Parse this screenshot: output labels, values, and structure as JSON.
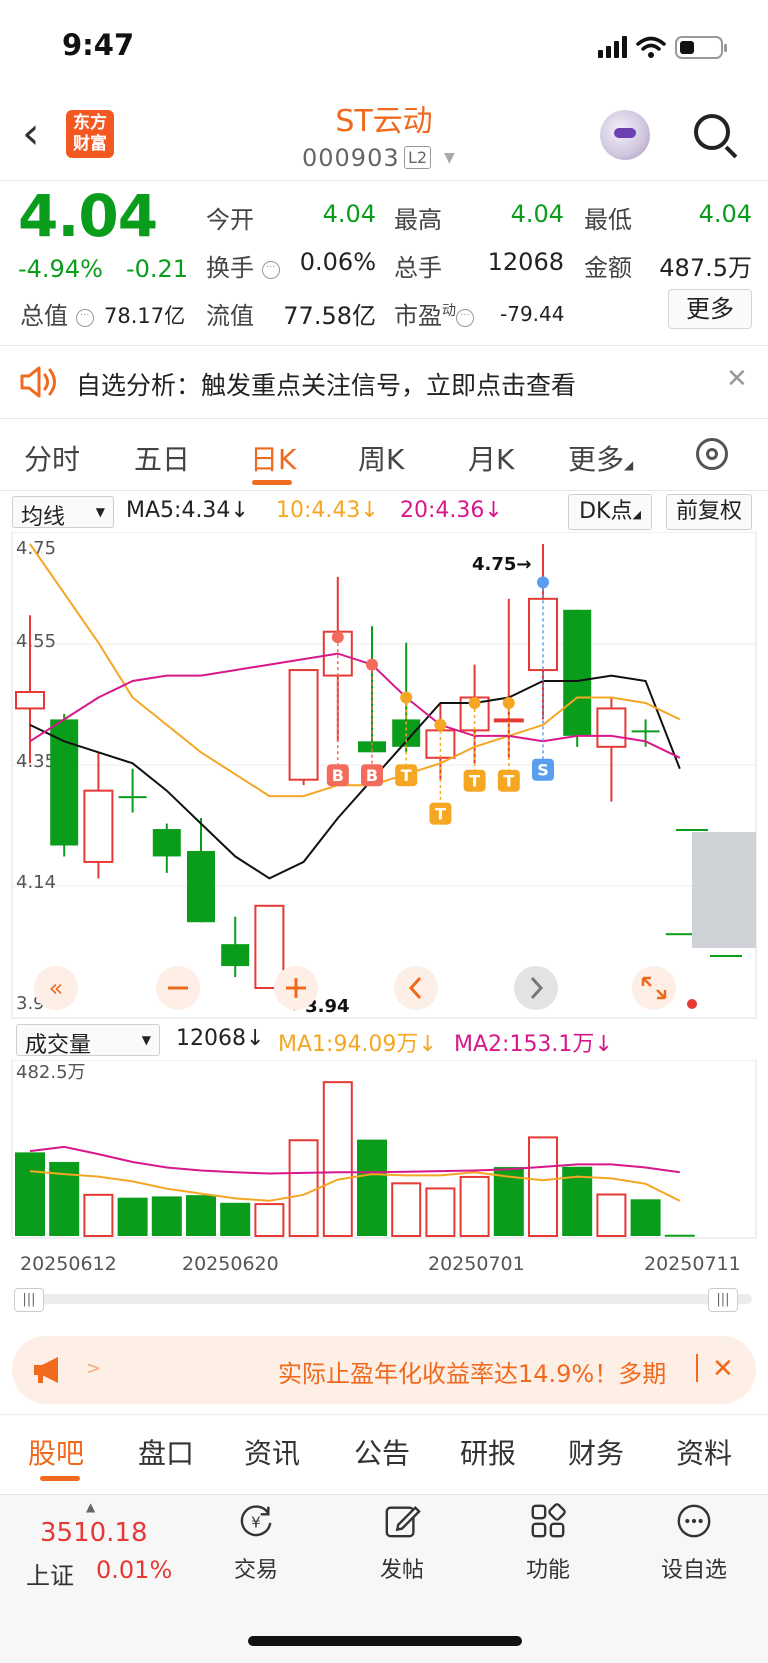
{
  "status_bar": {
    "time": "9:47"
  },
  "header": {
    "logo_text": "东方财富",
    "stock_name": "ST云动",
    "stock_code": "000903",
    "level_badge": "L2"
  },
  "quote": {
    "price": "4.04",
    "change_pct": "-4.94%",
    "change_abs": "-0.21",
    "fields": {
      "open_label": "今开",
      "open": "4.04",
      "high_label": "最高",
      "high": "4.04",
      "low_label": "最低",
      "low": "4.04",
      "turnover_label": "换手",
      "turnover": "0.06%",
      "volume_label": "总手",
      "volume": "12068",
      "amount_label": "金额",
      "amount": "487.5万",
      "mktcap_label": "总值",
      "mktcap": "78.17亿",
      "float_label": "流值",
      "float": "77.58亿",
      "pe_label": "市盈",
      "pe_sup": "动",
      "pe": "-79.44"
    },
    "more_label": "更多"
  },
  "notice": {
    "text": "自选分析：触发重点关注信号，立即点击查看"
  },
  "tabs": [
    {
      "label": "分时"
    },
    {
      "label": "五日"
    },
    {
      "label": "日K"
    },
    {
      "label": "周K"
    },
    {
      "label": "月K"
    },
    {
      "label": "更多"
    }
  ],
  "kline": {
    "indicator_select": "均线",
    "ma5": "MA5:4.34",
    "ma10": "10:4.43",
    "ma20": "20:4.36",
    "dk_label": "DK点",
    "restore_label": "前复权",
    "y_ticks": [
      "4.75",
      "4.55",
      "4.35",
      "4.14",
      "3.94"
    ],
    "max_marker": "4.75",
    "min_marker": "3.94",
    "colors": {
      "up": "#e53935",
      "down": "#0a9d1c",
      "ma5": "#111111",
      "ma10": "#f5a623",
      "ma20": "#d8178b"
    }
  },
  "volume_panel": {
    "indicator_select": "成交量",
    "vol": "12068",
    "ma1": "MA1:94.09万",
    "ma2": "MA2:153.1万",
    "y_max": "482.5万",
    "dates": [
      "20250612",
      "20250620",
      "20250701",
      "20250711"
    ]
  },
  "chart_data": {
    "type": "candlestick",
    "title": "",
    "ylim": [
      3.94,
      4.75
    ],
    "candles": [
      {
        "open": 4.45,
        "close": 4.48,
        "high": 4.62,
        "low": 4.35,
        "dir": "up"
      },
      {
        "open": 4.43,
        "close": 4.2,
        "high": 4.44,
        "low": 4.18,
        "dir": "down"
      },
      {
        "open": 4.17,
        "close": 4.3,
        "high": 4.37,
        "low": 4.14,
        "dir": "up"
      },
      {
        "open": 4.29,
        "close": 4.29,
        "high": 4.34,
        "low": 4.26,
        "dir": "flat"
      },
      {
        "open": 4.23,
        "close": 4.18,
        "high": 4.24,
        "low": 4.15,
        "dir": "down"
      },
      {
        "open": 4.19,
        "close": 4.06,
        "high": 4.25,
        "low": 4.06,
        "dir": "down"
      },
      {
        "open": 4.02,
        "close": 3.98,
        "high": 4.07,
        "low": 3.96,
        "dir": "down"
      },
      {
        "open": 3.94,
        "close": 4.09,
        "high": 4.09,
        "low": 3.94,
        "dir": "up"
      },
      {
        "open": 4.32,
        "close": 4.52,
        "high": 4.52,
        "low": 4.31,
        "dir": "up"
      },
      {
        "open": 4.51,
        "close": 4.59,
        "high": 4.69,
        "low": 4.39,
        "dir": "up"
      },
      {
        "open": 4.39,
        "close": 4.37,
        "high": 4.6,
        "low": 4.37,
        "dir": "down"
      },
      {
        "open": 4.43,
        "close": 4.38,
        "high": 4.57,
        "low": 4.37,
        "dir": "down"
      },
      {
        "open": 4.36,
        "close": 4.41,
        "high": 4.46,
        "low": 4.32,
        "dir": "up"
      },
      {
        "open": 4.41,
        "close": 4.47,
        "high": 4.53,
        "low": 4.35,
        "dir": "up"
      },
      {
        "open": 4.43,
        "close": 4.43,
        "high": 4.65,
        "low": 4.36,
        "dir": "up"
      },
      {
        "open": 4.52,
        "close": 4.65,
        "high": 4.75,
        "low": 4.43,
        "dir": "up"
      },
      {
        "open": 4.63,
        "close": 4.4,
        "high": 4.63,
        "low": 4.38,
        "dir": "down"
      },
      {
        "open": 4.38,
        "close": 4.45,
        "high": 4.47,
        "low": 4.28,
        "dir": "up"
      },
      {
        "open": 4.41,
        "close": 4.41,
        "high": 4.43,
        "low": 4.38,
        "dir": "flat"
      },
      {
        "open": 4.04,
        "close": 4.04,
        "high": 4.04,
        "low": 4.04,
        "dir": "down"
      }
    ],
    "signals": [
      "B",
      "B",
      "T",
      "T",
      "T",
      "T",
      "S"
    ],
    "ma5": [
      4.42,
      4.39,
      4.37,
      4.35,
      4.3,
      4.24,
      4.18,
      4.14,
      4.17,
      4.25,
      4.32,
      4.39,
      4.46,
      4.46,
      4.47,
      4.5,
      4.5,
      4.51,
      4.5,
      4.34
    ],
    "ma10": [
      4.75,
      4.66,
      4.57,
      4.47,
      4.42,
      4.37,
      4.33,
      4.29,
      4.29,
      4.31,
      4.31,
      4.33,
      4.35,
      4.38,
      4.4,
      4.42,
      4.47,
      4.47,
      4.46,
      4.43
    ],
    "ma20": [
      4.39,
      4.43,
      4.47,
      4.5,
      4.51,
      4.51,
      4.52,
      4.53,
      4.54,
      4.55,
      4.53,
      4.47,
      4.42,
      4.4,
      4.4,
      4.39,
      4.4,
      4.4,
      4.39,
      4.36
    ],
    "volume_max_wan": 482.5,
    "volumes_wan": [
      262,
      232,
      129,
      120,
      124,
      128,
      104,
      100,
      300,
      482,
      302,
      165,
      149,
      185,
      216,
      309,
      217,
      130,
      115,
      4
    ],
    "volume_dir": [
      "down",
      "down",
      "up",
      "down",
      "down",
      "down",
      "down",
      "up",
      "up",
      "up",
      "down",
      "up",
      "up",
      "up",
      "down",
      "up",
      "down",
      "up",
      "down",
      "down"
    ]
  },
  "ad": {
    "text": "实际止盈年化收益率达14.9%！多期",
    "arrow": ">"
  },
  "bottom_tabs": [
    {
      "label": "股吧"
    },
    {
      "label": "盘口"
    },
    {
      "label": "资讯"
    },
    {
      "label": "公告"
    },
    {
      "label": "研报"
    },
    {
      "label": "财务"
    },
    {
      "label": "资料"
    }
  ],
  "toolbar": {
    "index_value": "3510.18",
    "index_name": "上证",
    "index_change": "0.01%",
    "items": [
      {
        "label": "交易",
        "icon": "yen-cycle-icon"
      },
      {
        "label": "发帖",
        "icon": "edit-icon"
      },
      {
        "label": "功能",
        "icon": "grid-icon"
      },
      {
        "label": "设自选",
        "icon": "more-dots-icon"
      }
    ]
  }
}
